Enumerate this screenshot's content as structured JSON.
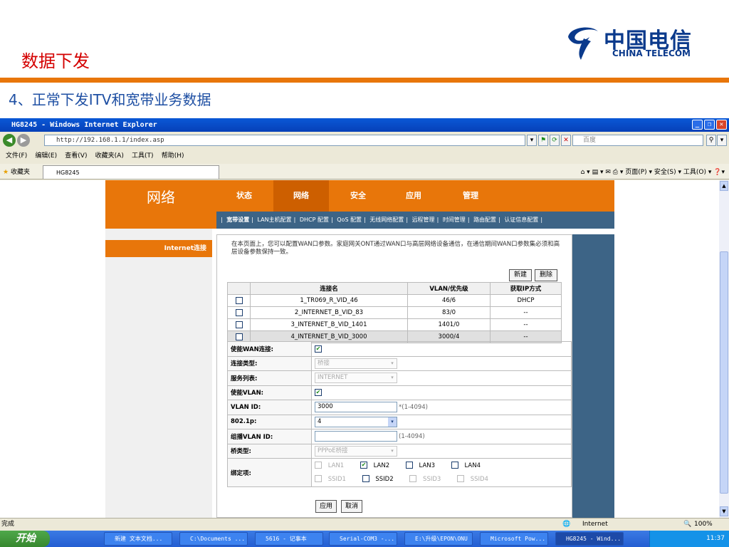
{
  "slide": {
    "title": "数据下发",
    "subtitle": "4、正常下发ITV和宽带业务数据",
    "logo_cn": "中国电信",
    "logo_en": "CHINA TELECOM"
  },
  "browser": {
    "window_title": "HG8245 - Windows Internet Explorer",
    "address": "http://192.168.1.1/index.asp",
    "search_placeholder": "百度",
    "menu": [
      "文件(F)",
      "编辑(E)",
      "查看(V)",
      "收藏夹(A)",
      "工具(T)",
      "帮助(H)"
    ],
    "favorites_label": "收藏夹",
    "tab_label": "HG8245",
    "command_bar": "页面(P) ▾  安全(S) ▾  工具(O) ▾",
    "status_text": "完成",
    "status_zone": "Internet",
    "zoom": "100%"
  },
  "router": {
    "section_title": "网络",
    "nav": [
      "状态",
      "网络",
      "安全",
      "应用",
      "管理"
    ],
    "subnav": [
      "宽带设置",
      "LAN主机配置",
      "DHCP 配置",
      "QoS 配置",
      "无线网络配置",
      "远程管理",
      "时间管理",
      "路由配置",
      "认证信息配置"
    ],
    "side_item": "Internet连接",
    "description": "在本页面上，您可以配置WAN口参数。家庭网关ONT通过WAN口与高层网络设备通信，在通信期间WAN口参数集必须和高层设备参数保持一致。",
    "btn_new": "新建",
    "btn_delete": "删除",
    "table_headers": [
      "连接名",
      "VLAN/优先级",
      "获取IP方式"
    ],
    "connections": [
      {
        "name": "1_TR069_R_VID_46",
        "vlan": "46/6",
        "ip": "DHCP"
      },
      {
        "name": "2_INTERNET_B_VID_83",
        "vlan": "83/0",
        "ip": "--"
      },
      {
        "name": "3_INTERNET_B_VID_1401",
        "vlan": "1401/0",
        "ip": "--"
      },
      {
        "name": "4_INTERNET_B_VID_3000",
        "vlan": "3000/4",
        "ip": "--"
      }
    ],
    "form": {
      "enable_wan_label": "使能WAN连接:",
      "conn_type_label": "连接类型:",
      "conn_type_value": "桥接",
      "service_label": "服务列表:",
      "service_value": "INTERNET",
      "enable_vlan_label": "使能VLAN:",
      "vlan_id_label": "VLAN ID:",
      "vlan_id_value": "3000",
      "vlan_id_hint": "*(1-4094)",
      "p8021_label": "802.1p:",
      "p8021_value": "4",
      "mcast_label": "组播VLAN ID:",
      "mcast_value": "",
      "mcast_hint": "(1-4094)",
      "bridge_type_label": "桥类型:",
      "bridge_type_value": "PPPoE桥接",
      "bind_label": "绑定项:",
      "bind_row1": [
        "LAN1",
        "LAN2",
        "LAN3",
        "LAN4"
      ],
      "bind_row2": [
        "SSID1",
        "SSID2",
        "SSID3",
        "SSID4"
      ]
    },
    "btn_apply": "应用",
    "btn_cancel": "取消"
  },
  "taskbar": {
    "start": "开始",
    "tasks": [
      "新建 文本文档...",
      "C:\\Documents ...",
      "5616 - 记事本",
      "Serial-COM3 -...",
      "E:\\升级\\EPON\\ONU",
      "Microsoft Pow...",
      "HG8245 - Wind..."
    ],
    "clock": "11:37"
  },
  "colors": {
    "accent_orange": "#e8760a",
    "title_red": "#d40000",
    "subtitle_blue": "#1e4fa3",
    "router_blue": "#3d6486"
  }
}
